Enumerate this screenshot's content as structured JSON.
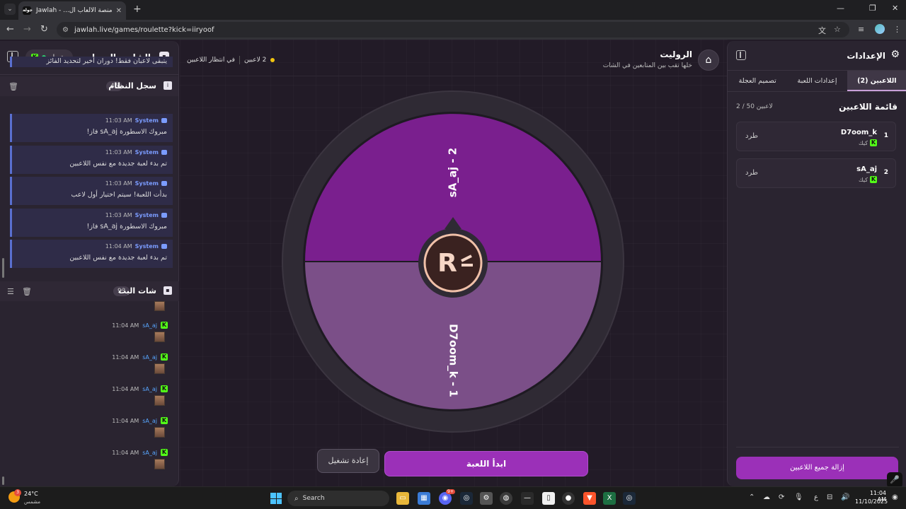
{
  "browser": {
    "tab_title": "منصة الألعاب ال... - Jawlah | جولة",
    "tab_favicon": "جولة",
    "url": "jawlah.live/games/roulette?kick=iiryoof",
    "icons": [
      "menu-icon",
      "close-icon",
      "plus-icon",
      "minimize-icon",
      "restore-icon",
      "back-icon",
      "forward-icon",
      "reload-icon",
      "site-info-icon",
      "translate-icon",
      "star-icon",
      "reading-list-icon",
      "profile-avatar",
      "kebab-menu-icon"
    ]
  },
  "left_panel": {
    "title": "الشات والسجل",
    "connection_status": "متصل",
    "system_log": {
      "title": "سجل النظام",
      "count": "46",
      "partial_message": "يتبقى لاعبان فقط! دوران أخير لتحديد الفائز",
      "messages": [
        {
          "sender": "System",
          "time": "11:03 AM",
          "text": "مبروك الاسطورة sA_aj فاز!"
        },
        {
          "sender": "System",
          "time": "11:03 AM",
          "text": "تم بدء لعبة جديدة مع نفس اللاعبين"
        },
        {
          "sender": "System",
          "time": "11:03 AM",
          "text": "بدأت اللعبة! سيتم اختيار أول لاعب"
        },
        {
          "sender": "System",
          "time": "11:03 AM",
          "text": "مبروك الاسطورة sA_aj فاز!"
        },
        {
          "sender": "System",
          "time": "11:04 AM",
          "text": "تم بدء لعبة جديدة مع نفس اللاعبين"
        }
      ]
    },
    "stream_chat": {
      "title": "شات البث",
      "count": "93",
      "messages": [
        {
          "user": "sA_aj",
          "time": "11:04 AM"
        },
        {
          "user": "sA_aj",
          "time": "11:04 AM"
        },
        {
          "user": "sA_aj",
          "time": "11:04 AM"
        },
        {
          "user": "sA_aj",
          "time": "11:04 AM"
        },
        {
          "user": "sA_aj",
          "time": "11:04 AM"
        }
      ]
    }
  },
  "center": {
    "title": "الروليت",
    "subtitle": "خلها تقب بين المتابعين في الشات",
    "player_count_label": "2 لاعبين",
    "status": "في انتظار اللاعبين",
    "wheel": {
      "segments": [
        {
          "label": "sA_aj - 2",
          "color": "#7a1f8e"
        },
        {
          "label": "D7oom_k - 1",
          "color": "#7b4f88"
        }
      ],
      "logo": "R"
    },
    "reset_button": "إعادة تشغيل",
    "start_button": "ابدأ اللعبة"
  },
  "right_panel": {
    "title": "الإعدادات",
    "tabs": [
      "اللاعبين (2)",
      "إعدادات اللعبة",
      "تصميم العجلة"
    ],
    "active_tab": 0,
    "players_title": "قائمة اللاعبين",
    "players_count": "2 / 50 لاعبين",
    "players": [
      {
        "num": "1",
        "name": "D7oom_k",
        "source": "كيك",
        "kick_label": "طرد"
      },
      {
        "num": "2",
        "name": "sA_aj",
        "source": "كيك",
        "kick_label": "طرد"
      }
    ],
    "remove_all_button": "إزالة جميع اللاعبين"
  },
  "taskbar": {
    "weather_temp": "24°C",
    "weather_condition": "مشمس",
    "weather_badge": "3",
    "search_label": "Search",
    "language": "ع",
    "time": "11:04 AM",
    "date": "11/10/2025",
    "discord_badge": "9+"
  },
  "colors": {
    "accent": "#9b30b8",
    "kick_green": "#53fc18",
    "system_blue": "#7b9cff",
    "wheel_top": "#7a1f8e",
    "wheel_bottom": "#7b4f88"
  }
}
